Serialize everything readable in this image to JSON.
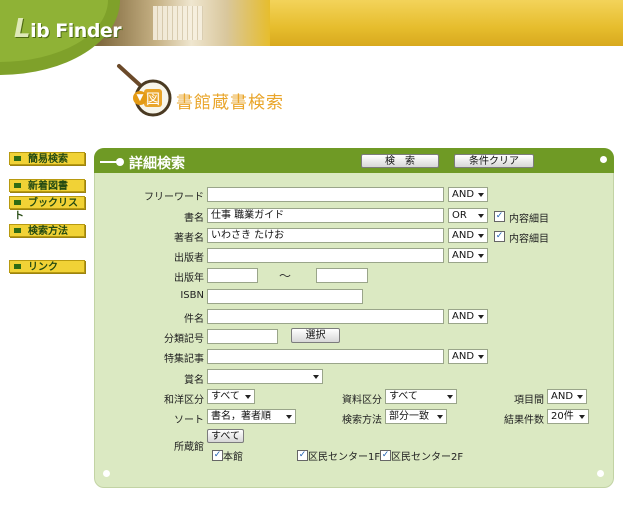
{
  "header": {
    "logo_initial": "L",
    "logo_rest": "ib Finder"
  },
  "page_title": "書館蔵書検索",
  "title_icon": "▼",
  "sidebar": {
    "items": [
      {
        "label": "簡易検索"
      },
      {
        "label": "新着図書"
      },
      {
        "label": "ブックリスト"
      },
      {
        "label": "検索方法"
      },
      {
        "label": "リンク"
      }
    ]
  },
  "panel": {
    "title": "詳細検索",
    "search_button": "検　索",
    "clear_button": "条件クリア"
  },
  "form": {
    "free_word": {
      "label": "フリーワード",
      "value": "",
      "op": "AND"
    },
    "title": {
      "label": "書名",
      "value": "仕事 職業ガイド",
      "op": "OR",
      "detail_label": "内容細目",
      "detail_checked": "✓"
    },
    "author": {
      "label": "著者名",
      "value": "いわさき たけお",
      "op": "AND",
      "detail_label": "内容細目",
      "detail_checked": "✓"
    },
    "publisher": {
      "label": "出版者",
      "value": "",
      "op": "AND"
    },
    "pub_year": {
      "label": "出版年",
      "from": "",
      "tilde": "～",
      "to": ""
    },
    "isbn": {
      "label": "ISBN",
      "value": ""
    },
    "subject": {
      "label": "件名",
      "value": "",
      "op": "AND"
    },
    "classification": {
      "label": "分類記号",
      "value": "",
      "select_button": "選択"
    },
    "special": {
      "label": "特集記事",
      "value": "",
      "op": "AND"
    },
    "award": {
      "label": "賞名",
      "value": ""
    },
    "language": {
      "label": "和洋区分",
      "value": "すべて"
    },
    "material": {
      "label": "資料区分",
      "value": "すべて"
    },
    "between": {
      "label": "項目間",
      "value": "AND"
    },
    "sort": {
      "label": "ソート",
      "value": "書名，著者順"
    },
    "method": {
      "label": "検索方法",
      "value": "部分一致"
    },
    "count": {
      "label": "結果件数",
      "value": "20件"
    },
    "location": {
      "label": "所蔵館",
      "all_button": "すべて",
      "options": [
        {
          "label": "本館",
          "checked": "✓"
        },
        {
          "label": "区民センター1F",
          "checked": "✓"
        },
        {
          "label": "区民センター2F",
          "checked": "✓"
        }
      ]
    }
  }
}
